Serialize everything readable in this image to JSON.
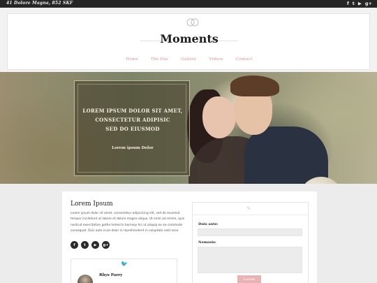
{
  "topbar": {
    "address": "41 Dolore Magna, 852 SKF",
    "social": [
      "f",
      "t",
      "▶",
      "g+"
    ]
  },
  "header": {
    "brand": "Moments",
    "nav": [
      "Home",
      "The Day",
      "Gallery",
      "Videos",
      "Contact"
    ]
  },
  "hero": {
    "title_line1": "Lorem ipsum dolor sit amet,",
    "title_line2": "consectetur adipisic",
    "title_line3": "sed do eiusmod",
    "subtitle": "Lorem ipsum Dolor"
  },
  "about": {
    "title": "Lorem Ipsum",
    "text": "Lorem ipsum dolor sit amet, consectetur adipisicing elit, sed do eiusmod tempor incididunt ut labore et dolore magna aliqua. Ut enim ad minim, quis nostrud exercitation gothe hetescin barnsey hic ut aliquip ex ea commodo consequat. Duis aute irure dolor in reprehenderit in voluptate velit esse.",
    "social": [
      "f",
      "t",
      "▶",
      "g+"
    ]
  },
  "tweet": {
    "name": "Rhys Parry"
  },
  "form": {
    "label1": "Duis aute:",
    "label2": "Nemosis:",
    "button": "Lorem"
  }
}
